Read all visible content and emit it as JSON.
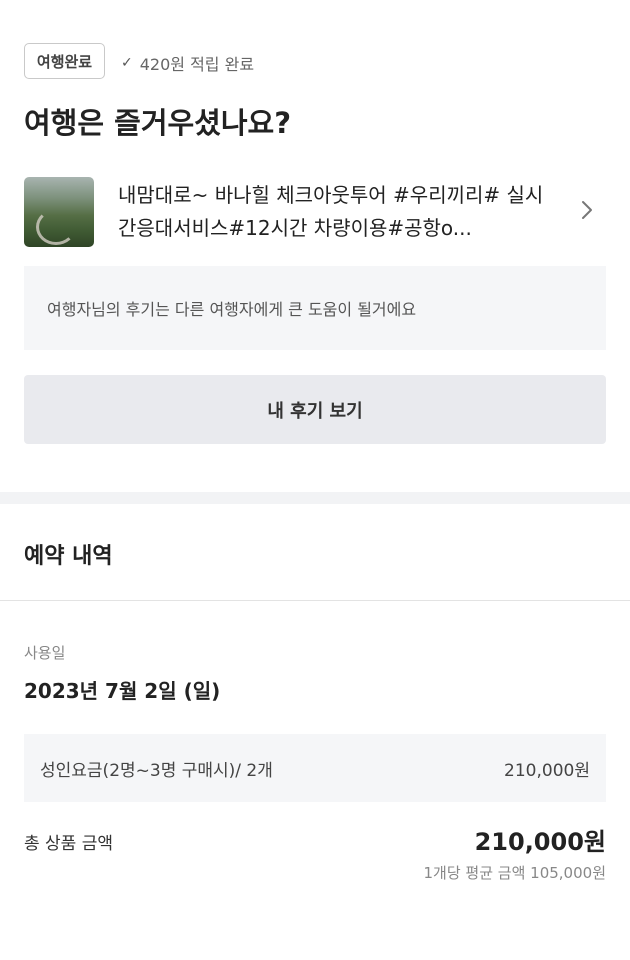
{
  "completion": {
    "badge_label": "여행완료",
    "points_text": "420원 적립 완료",
    "question": "여행은 즐거우셨나요?"
  },
  "product": {
    "thumbnail_icon": "landscape-photo",
    "title": "내맘대로~ 바나힐 체크아웃투어 #우리끼리# 실시간응대서비스#12시간 차량이용#공항o..."
  },
  "review": {
    "prompt_text": "여행자님의 후기는 다른 여행자에게 큰 도움이 될거에요",
    "button_label": "내 후기 보기"
  },
  "booking": {
    "section_title": "예약 내역",
    "use_date_label": "사용일",
    "use_date_value": "2023년 7월 2일 (일)",
    "price_item_label": "성인요금(2명~3명 구매시)/ 2개",
    "price_item_value": "210,000원",
    "total_label": "총 상품 금액",
    "total_value": "210,000원",
    "average_text": "1개당 평균 금액 105,000원"
  },
  "colors": {
    "background": "#ffffff",
    "panel": "#f5f6f8",
    "button": "#e9eaee",
    "section_gap": "#f2f3f5"
  }
}
